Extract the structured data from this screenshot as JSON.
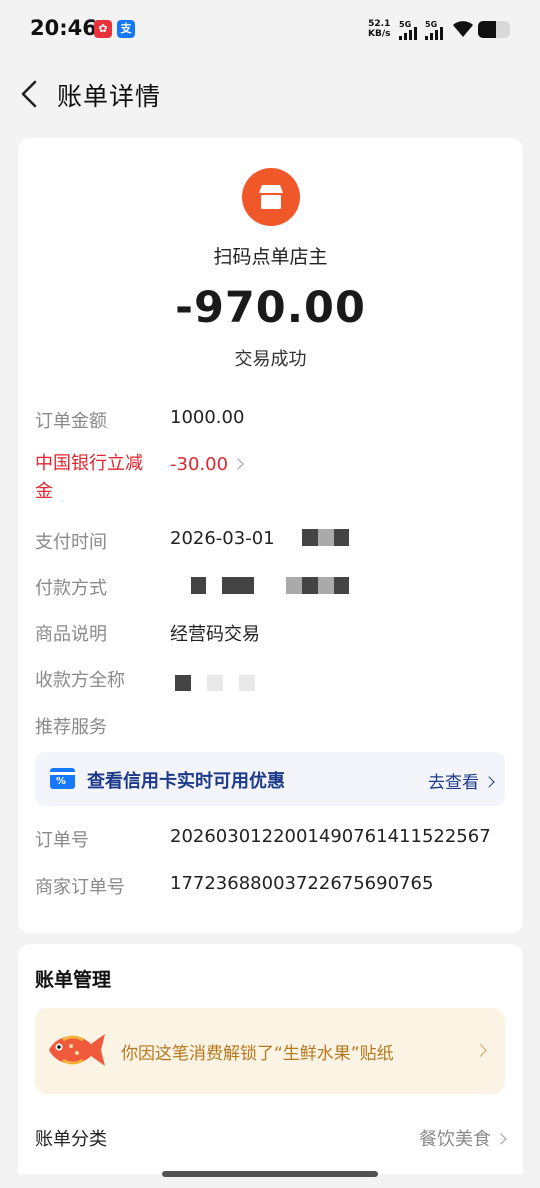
{
  "status_bar": {
    "time": "20:46",
    "net_speed_value": "52.1",
    "net_speed_unit": "KB/s",
    "signal_1": "5G",
    "signal_2": "5G"
  },
  "header": {
    "title": "账单详情"
  },
  "merchant": {
    "name": "扫码点单店主",
    "amount": "-970.00",
    "status": "交易成功",
    "logo_color": "#f0582a"
  },
  "details": {
    "order_amount_label": "订单金额",
    "order_amount_value": "1000.00",
    "discount_label": "中国银行立减金",
    "discount_value": "-30.00",
    "pay_time_label": "支付时间",
    "pay_time_value": "2026-03-01",
    "pay_method_label": "付款方式",
    "product_desc_label": "商品说明",
    "product_desc_value": "经营码交易",
    "payee_label": "收款方全称",
    "recommend_label": "推荐服务",
    "order_no_label": "订单号",
    "order_no_value": "2026030122001490761411522567",
    "merchant_order_label": "商家订单号",
    "merchant_order_value": "17723688003722675690765"
  },
  "promo": {
    "text": "查看信用卡实时可用优惠",
    "link": "去查看"
  },
  "bill_management": {
    "title": "账单管理",
    "sticker_text": "你因这笔消费解锁了“生鲜水果”贴纸",
    "category_label": "账单分类",
    "category_value": "餐饮美食"
  },
  "colors": {
    "accent_red": "#e0262e",
    "link_blue": "#1d3a8a",
    "sticker_gold": "#b7791f"
  }
}
